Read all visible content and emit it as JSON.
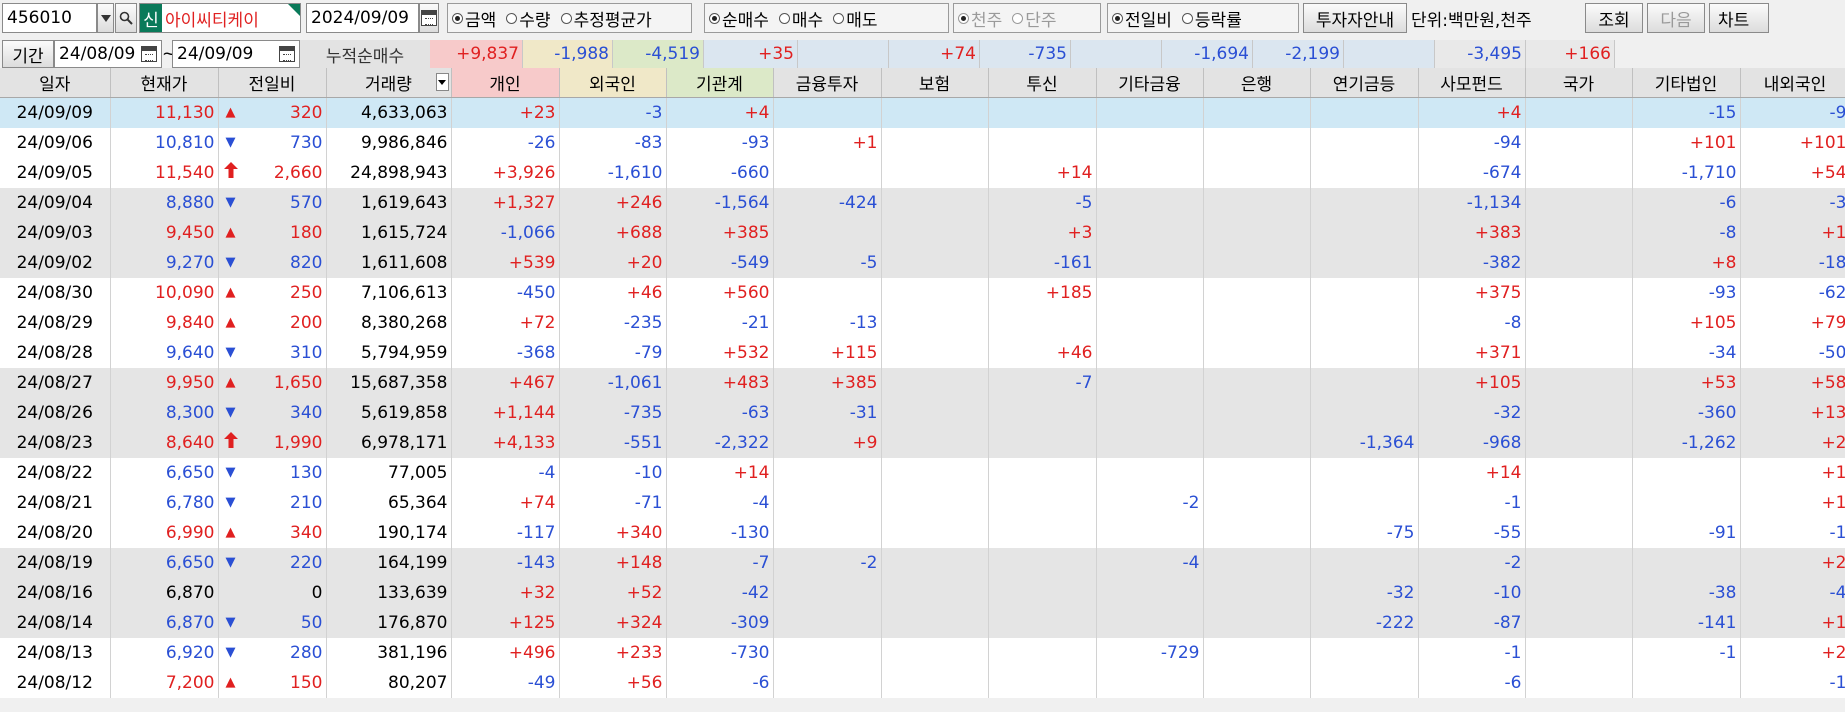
{
  "toolbar": {
    "code": "456010",
    "stock_badge": "신",
    "stock_name": "아이씨티케이",
    "date": "2024/09/09",
    "unit_radios": [
      {
        "label": "금액",
        "checked": true
      },
      {
        "label": "수량",
        "checked": false
      },
      {
        "label": "추정평균가",
        "checked": false
      }
    ],
    "trade_radios": [
      {
        "label": "순매수",
        "checked": true
      },
      {
        "label": "매수",
        "checked": false
      },
      {
        "label": "매도",
        "checked": false
      }
    ],
    "share_radios": [
      {
        "label": "천주",
        "checked": true
      },
      {
        "label": "단주",
        "checked": false
      }
    ],
    "compare_radios": [
      {
        "label": "전일비",
        "checked": true
      },
      {
        "label": "등락률",
        "checked": false
      }
    ],
    "investor_guide": "투자자안내",
    "unit_text": "단위:백만원,천주",
    "query": "조회",
    "next": "다음",
    "chart": "차트"
  },
  "period": {
    "label": "기간",
    "from": "24/08/09",
    "tilde": "~",
    "to": "24/09/09",
    "cumulative_label": "누적순매수"
  },
  "summary": [
    "+9,837",
    "-1,988",
    "-4,519",
    "+35",
    "",
    "+74",
    "-735",
    "",
    "-1,694",
    "-2,199",
    "",
    "-3,495",
    "+166"
  ],
  "columns": [
    "일자",
    "현재가",
    "전일비",
    "거래량",
    "개인",
    "외국인",
    "기관계",
    "금융투자",
    "보험",
    "투신",
    "기타금융",
    "은행",
    "연기금등",
    "사모펀드",
    "국가",
    "기타법인",
    "내외국인"
  ],
  "rows": [
    {
      "date": "24/09/09",
      "price": "11,130",
      "dir": "up",
      "chg": "320",
      "vol": "4,633,063",
      "inv": [
        "+23",
        "-3",
        "+4",
        "",
        "",
        "",
        "",
        "",
        "",
        "+4",
        "",
        "-15",
        "-9"
      ]
    },
    {
      "date": "24/09/06",
      "price": "10,810",
      "dir": "down",
      "chg": "730",
      "vol": "9,986,846",
      "inv": [
        "-26",
        "-83",
        "-93",
        "+1",
        "",
        "",
        "",
        "",
        "",
        "-94",
        "",
        "+101",
        "+101"
      ]
    },
    {
      "date": "24/09/05",
      "price": "11,540",
      "dir": "limitup",
      "chg": "2,660",
      "vol": "24,898,943",
      "inv": [
        "+3,926",
        "-1,610",
        "-660",
        "",
        "",
        "+14",
        "",
        "",
        "",
        "-674",
        "",
        "-1,710",
        "+54"
      ]
    },
    {
      "date": "24/09/04",
      "price": "8,880",
      "dir": "down",
      "chg": "570",
      "vol": "1,619,643",
      "inv": [
        "+1,327",
        "+246",
        "-1,564",
        "-424",
        "",
        "-5",
        "",
        "",
        "",
        "-1,134",
        "",
        "-6",
        "-3"
      ]
    },
    {
      "date": "24/09/03",
      "price": "9,450",
      "dir": "up",
      "chg": "180",
      "vol": "1,615,724",
      "inv": [
        "-1,066",
        "+688",
        "+385",
        "",
        "",
        "+3",
        "",
        "",
        "",
        "+383",
        "",
        "-8",
        "+1"
      ]
    },
    {
      "date": "24/09/02",
      "price": "9,270",
      "dir": "down",
      "chg": "820",
      "vol": "1,611,608",
      "inv": [
        "+539",
        "+20",
        "-549",
        "-5",
        "",
        "-161",
        "",
        "",
        "",
        "-382",
        "",
        "+8",
        "-18"
      ]
    },
    {
      "date": "24/08/30",
      "price": "10,090",
      "dir": "up",
      "chg": "250",
      "vol": "7,106,613",
      "inv": [
        "-450",
        "+46",
        "+560",
        "",
        "",
        "+185",
        "",
        "",
        "",
        "+375",
        "",
        "-93",
        "-62"
      ]
    },
    {
      "date": "24/08/29",
      "price": "9,840",
      "dir": "up",
      "chg": "200",
      "vol": "8,380,268",
      "inv": [
        "+72",
        "-235",
        "-21",
        "-13",
        "",
        "",
        "",
        "",
        "",
        "-8",
        "",
        "+105",
        "+79"
      ]
    },
    {
      "date": "24/08/28",
      "price": "9,640",
      "dir": "down",
      "chg": "310",
      "vol": "5,794,959",
      "inv": [
        "-368",
        "-79",
        "+532",
        "+115",
        "",
        "+46",
        "",
        "",
        "",
        "+371",
        "",
        "-34",
        "-50"
      ]
    },
    {
      "date": "24/08/27",
      "price": "9,950",
      "dir": "up",
      "chg": "1,650",
      "vol": "15,687,358",
      "inv": [
        "+467",
        "-1,061",
        "+483",
        "+385",
        "",
        "-7",
        "",
        "",
        "",
        "+105",
        "",
        "+53",
        "+58"
      ]
    },
    {
      "date": "24/08/26",
      "price": "8,300",
      "dir": "down",
      "chg": "340",
      "vol": "5,619,858",
      "inv": [
        "+1,144",
        "-735",
        "-63",
        "-31",
        "",
        "",
        "",
        "",
        "",
        "-32",
        "",
        "-360",
        "+13"
      ]
    },
    {
      "date": "24/08/23",
      "price": "8,640",
      "dir": "limitup",
      "chg": "1,990",
      "vol": "6,978,171",
      "inv": [
        "+4,133",
        "-551",
        "-2,322",
        "+9",
        "",
        "",
        "",
        "",
        "-1,364",
        "-968",
        "",
        "-1,262",
        "+2"
      ]
    },
    {
      "date": "24/08/22",
      "price": "6,650",
      "dir": "down",
      "chg": "130",
      "vol": "77,005",
      "inv": [
        "-4",
        "-10",
        "+14",
        "",
        "",
        "",
        "",
        "",
        "",
        "+14",
        "",
        "",
        "+1"
      ]
    },
    {
      "date": "24/08/21",
      "price": "6,780",
      "dir": "down",
      "chg": "210",
      "vol": "65,364",
      "inv": [
        "+74",
        "-71",
        "-4",
        "",
        "",
        "",
        "-2",
        "",
        "",
        "-1",
        "",
        "",
        "+1"
      ]
    },
    {
      "date": "24/08/20",
      "price": "6,990",
      "dir": "up",
      "chg": "340",
      "vol": "190,174",
      "inv": [
        "-117",
        "+340",
        "-130",
        "",
        "",
        "",
        "",
        "",
        "-75",
        "-55",
        "",
        "-91",
        "-1"
      ]
    },
    {
      "date": "24/08/19",
      "price": "6,650",
      "dir": "down",
      "chg": "220",
      "vol": "164,199",
      "inv": [
        "-143",
        "+148",
        "-7",
        "-2",
        "",
        "",
        "-4",
        "",
        "",
        "-2",
        "",
        "",
        "+2"
      ]
    },
    {
      "date": "24/08/16",
      "price": "6,870",
      "dir": "flat",
      "chg": "0",
      "vol": "133,639",
      "inv": [
        "+32",
        "+52",
        "-42",
        "",
        "",
        "",
        "",
        "",
        "-32",
        "-10",
        "",
        "-38",
        "-4"
      ]
    },
    {
      "date": "24/08/14",
      "price": "6,870",
      "dir": "down",
      "chg": "50",
      "vol": "176,870",
      "inv": [
        "+125",
        "+324",
        "-309",
        "",
        "",
        "",
        "",
        "",
        "-222",
        "-87",
        "",
        "-141",
        "+1"
      ]
    },
    {
      "date": "24/08/13",
      "price": "6,920",
      "dir": "down",
      "chg": "280",
      "vol": "381,196",
      "inv": [
        "+496",
        "+233",
        "-730",
        "",
        "",
        "",
        "-729",
        "",
        "",
        "-1",
        "",
        "-1",
        "+2"
      ]
    },
    {
      "date": "24/08/12",
      "price": "7,200",
      "dir": "up",
      "chg": "150",
      "vol": "80,207",
      "inv": [
        "-49",
        "+56",
        "-6",
        "",
        "",
        "",
        "",
        "",
        "",
        "-6",
        "",
        "",
        "-1"
      ]
    }
  ],
  "row_shading": [
    "s",
    "w",
    "w",
    "g",
    "g",
    "g",
    "w",
    "w",
    "w",
    "g",
    "g",
    "g",
    "w",
    "w",
    "w",
    "g",
    "g",
    "g",
    "w",
    "w"
  ],
  "colors": {
    "up": "#e02020",
    "down": "#2a4fd4",
    "selected_row": "#cfe8f5",
    "grey_band": "#e5e5e5",
    "header_bg": "#e3e3e3",
    "badge_bg": "#0a7a5a"
  },
  "icons": {
    "dropdown": "chevron-down-icon",
    "search": "search-icon",
    "calendar": "calendar-icon",
    "up": "triangle-up-icon",
    "down": "triangle-down-icon",
    "limitup": "arrow-up-icon"
  }
}
